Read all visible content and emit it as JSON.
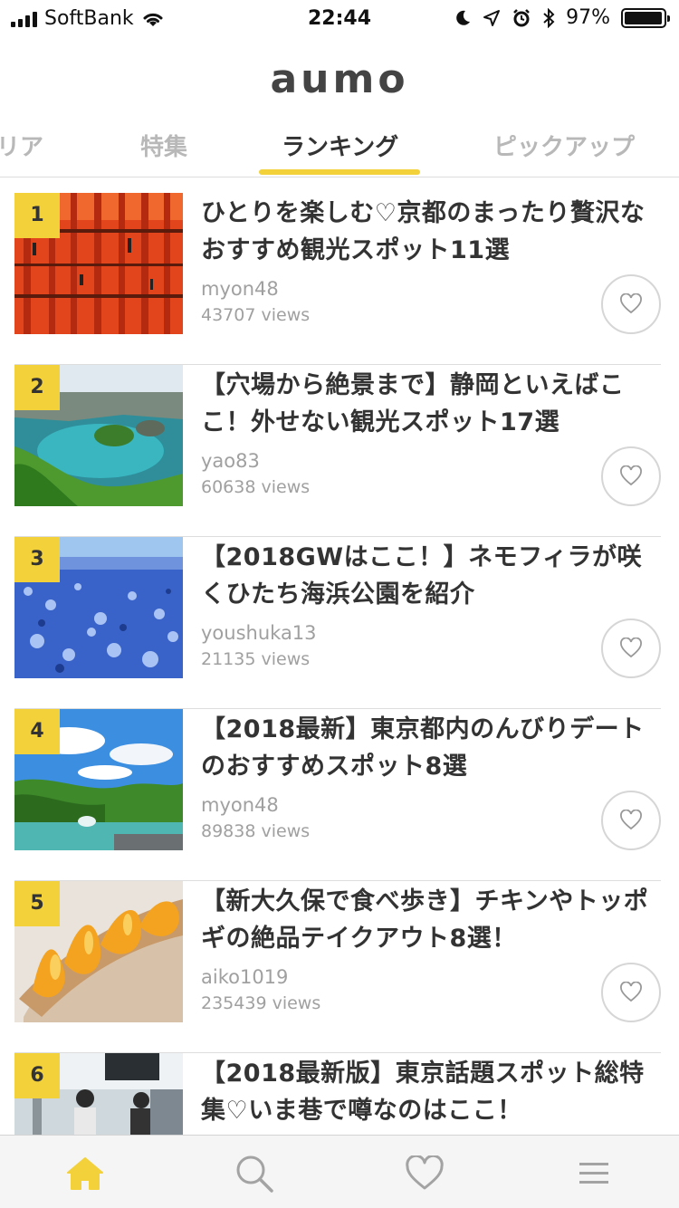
{
  "status_bar": {
    "carrier": "SoftBank",
    "time": "22:44",
    "battery": "97%",
    "battery_level": 0.97
  },
  "header": {
    "logo": "aumo"
  },
  "tabs": [
    {
      "label": "リア",
      "active": false
    },
    {
      "label": "特集",
      "active": false
    },
    {
      "label": "ランキング",
      "active": true
    },
    {
      "label": "ピックアップ",
      "active": false
    }
  ],
  "articles": [
    {
      "rank": "1",
      "title": "ひとりを楽しむ♡京都のまったり贅沢なおすすめ観光スポット11選",
      "author": "myon48",
      "views": "43707 views"
    },
    {
      "rank": "2",
      "title": "【穴場から絶景まで】静岡といえばここ！外せない観光スポット17選",
      "author": "yao83",
      "views": "60638 views"
    },
    {
      "rank": "3",
      "title": "【2018GWはここ！】ネモフィラが咲くひたち海浜公園を紹介",
      "author": "youshuka13",
      "views": "21135 views"
    },
    {
      "rank": "4",
      "title": "【2018最新】東京都内のんびりデートのおすすめスポット8選",
      "author": "myon48",
      "views": "89838 views"
    },
    {
      "rank": "5",
      "title": "【新大久保で食べ歩き】チキンやトッポギの絶品テイクアウト8選！",
      "author": "aiko1019",
      "views": "235439 views"
    },
    {
      "rank": "6",
      "title": "【2018最新版】東京話題スポット総特集♡いま巷で噂なのはここ！",
      "author": "",
      "views": ""
    }
  ],
  "bottom_nav": [
    {
      "icon": "home-icon",
      "active": true
    },
    {
      "icon": "search-icon",
      "active": false
    },
    {
      "icon": "heart-icon",
      "active": false
    },
    {
      "icon": "menu-icon",
      "active": false
    }
  ],
  "colors": {
    "accent": "#f2d13a",
    "text": "#333333",
    "muted": "#a0a0a0",
    "inactive_tab": "#b8b8b8"
  }
}
